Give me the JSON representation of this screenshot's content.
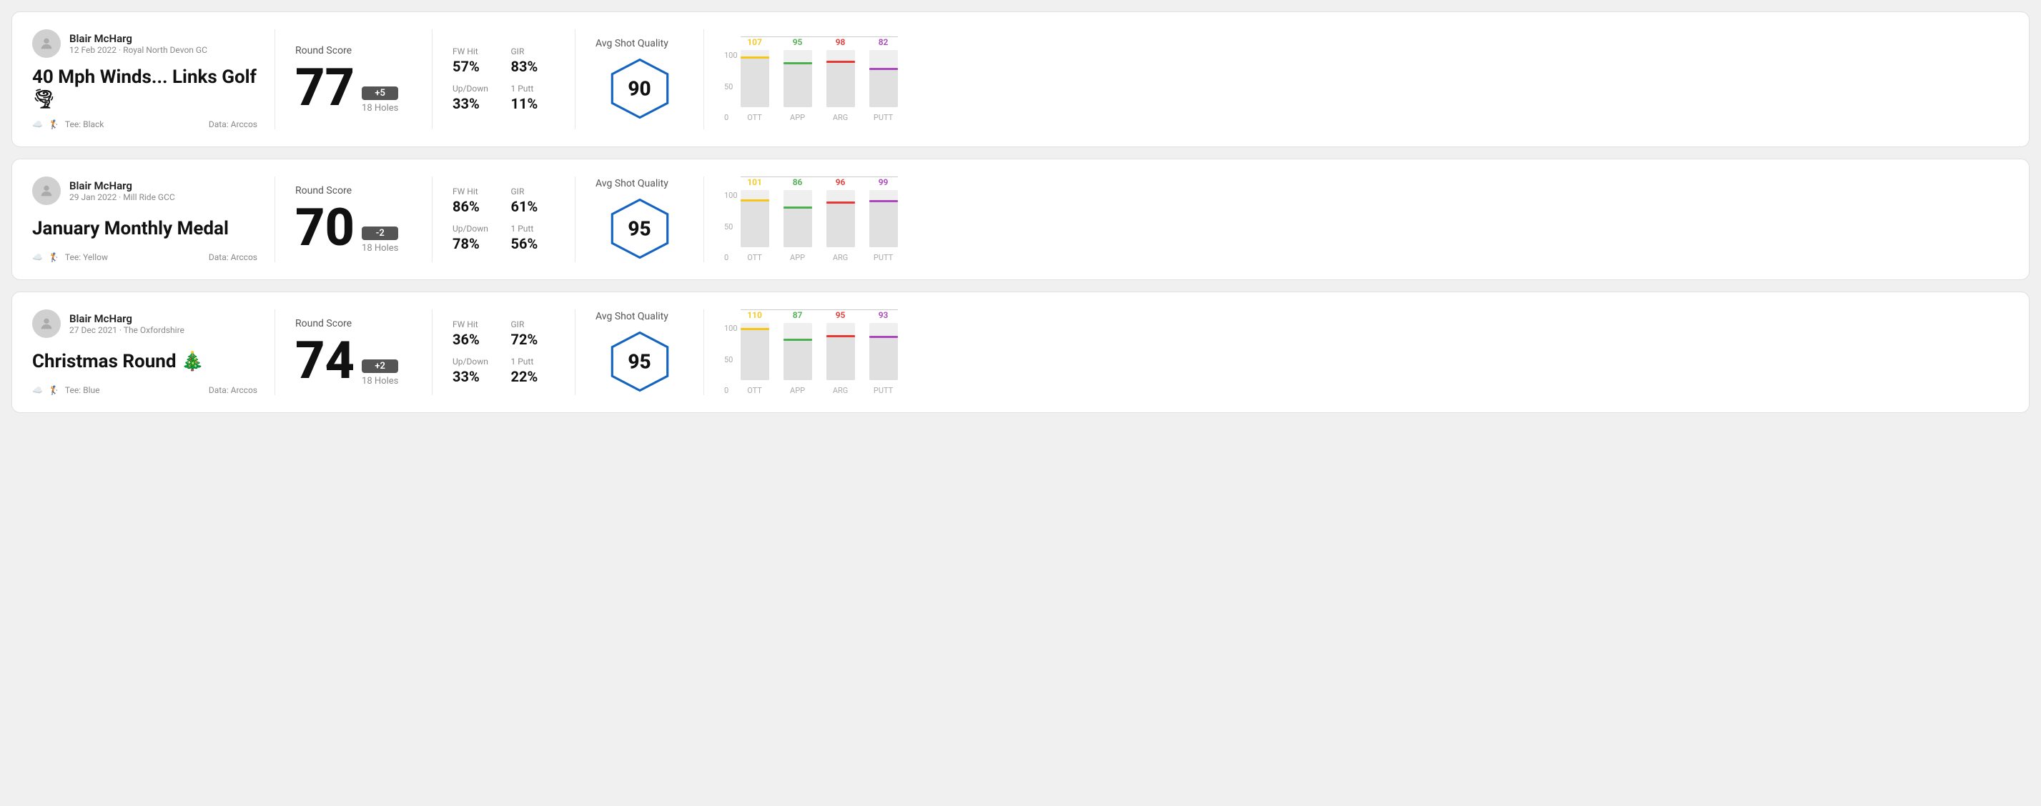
{
  "rounds": [
    {
      "id": "round1",
      "user": {
        "name": "Blair McHarg",
        "date_course": "12 Feb 2022 · Royal North Devon GC"
      },
      "title": "40 Mph Winds... Links Golf 🌪",
      "tee": "Black",
      "data_source": "Data: Arccos",
      "score": {
        "label": "Round Score",
        "number": "77",
        "badge": "+5",
        "badge_type": "positive",
        "holes": "18 Holes"
      },
      "stats": {
        "fw_hit_label": "FW Hit",
        "fw_hit_value": "57%",
        "gir_label": "GIR",
        "gir_value": "83%",
        "updown_label": "Up/Down",
        "updown_value": "33%",
        "oneputt_label": "1 Putt",
        "oneputt_value": "11%"
      },
      "quality": {
        "label": "Avg Shot Quality",
        "score": "90"
      },
      "chart": {
        "bars": [
          {
            "label": "OTT",
            "value": 107,
            "color": "#f5c518",
            "max": 150
          },
          {
            "label": "APP",
            "value": 95,
            "color": "#4caf50",
            "max": 150
          },
          {
            "label": "ARG",
            "value": 98,
            "color": "#e53935",
            "max": 150
          },
          {
            "label": "PUTT",
            "value": 82,
            "color": "#ab47bc",
            "max": 150
          }
        ]
      }
    },
    {
      "id": "round2",
      "user": {
        "name": "Blair McHarg",
        "date_course": "29 Jan 2022 · Mill Ride GCC"
      },
      "title": "January Monthly Medal",
      "tee": "Yellow",
      "data_source": "Data: Arccos",
      "score": {
        "label": "Round Score",
        "number": "70",
        "badge": "-2",
        "badge_type": "negative",
        "holes": "18 Holes"
      },
      "stats": {
        "fw_hit_label": "FW Hit",
        "fw_hit_value": "86%",
        "gir_label": "GIR",
        "gir_value": "61%",
        "updown_label": "Up/Down",
        "updown_value": "78%",
        "oneputt_label": "1 Putt",
        "oneputt_value": "56%"
      },
      "quality": {
        "label": "Avg Shot Quality",
        "score": "95"
      },
      "chart": {
        "bars": [
          {
            "label": "OTT",
            "value": 101,
            "color": "#f5c518",
            "max": 150
          },
          {
            "label": "APP",
            "value": 86,
            "color": "#4caf50",
            "max": 150
          },
          {
            "label": "ARG",
            "value": 96,
            "color": "#e53935",
            "max": 150
          },
          {
            "label": "PUTT",
            "value": 99,
            "color": "#ab47bc",
            "max": 150
          }
        ]
      }
    },
    {
      "id": "round3",
      "user": {
        "name": "Blair McHarg",
        "date_course": "27 Dec 2021 · The Oxfordshire"
      },
      "title": "Christmas Round 🎄",
      "tee": "Blue",
      "data_source": "Data: Arccos",
      "score": {
        "label": "Round Score",
        "number": "74",
        "badge": "+2",
        "badge_type": "positive",
        "holes": "18 Holes"
      },
      "stats": {
        "fw_hit_label": "FW Hit",
        "fw_hit_value": "36%",
        "gir_label": "GIR",
        "gir_value": "72%",
        "updown_label": "Up/Down",
        "updown_value": "33%",
        "oneputt_label": "1 Putt",
        "oneputt_value": "22%"
      },
      "quality": {
        "label": "Avg Shot Quality",
        "score": "95"
      },
      "chart": {
        "bars": [
          {
            "label": "OTT",
            "value": 110,
            "color": "#f5c518",
            "max": 150
          },
          {
            "label": "APP",
            "value": 87,
            "color": "#4caf50",
            "max": 150
          },
          {
            "label": "ARG",
            "value": 95,
            "color": "#e53935",
            "max": 150
          },
          {
            "label": "PUTT",
            "value": 93,
            "color": "#ab47bc",
            "max": 150
          }
        ]
      }
    }
  ],
  "y_axis": {
    "top": "100",
    "mid": "50",
    "bottom": "0"
  }
}
